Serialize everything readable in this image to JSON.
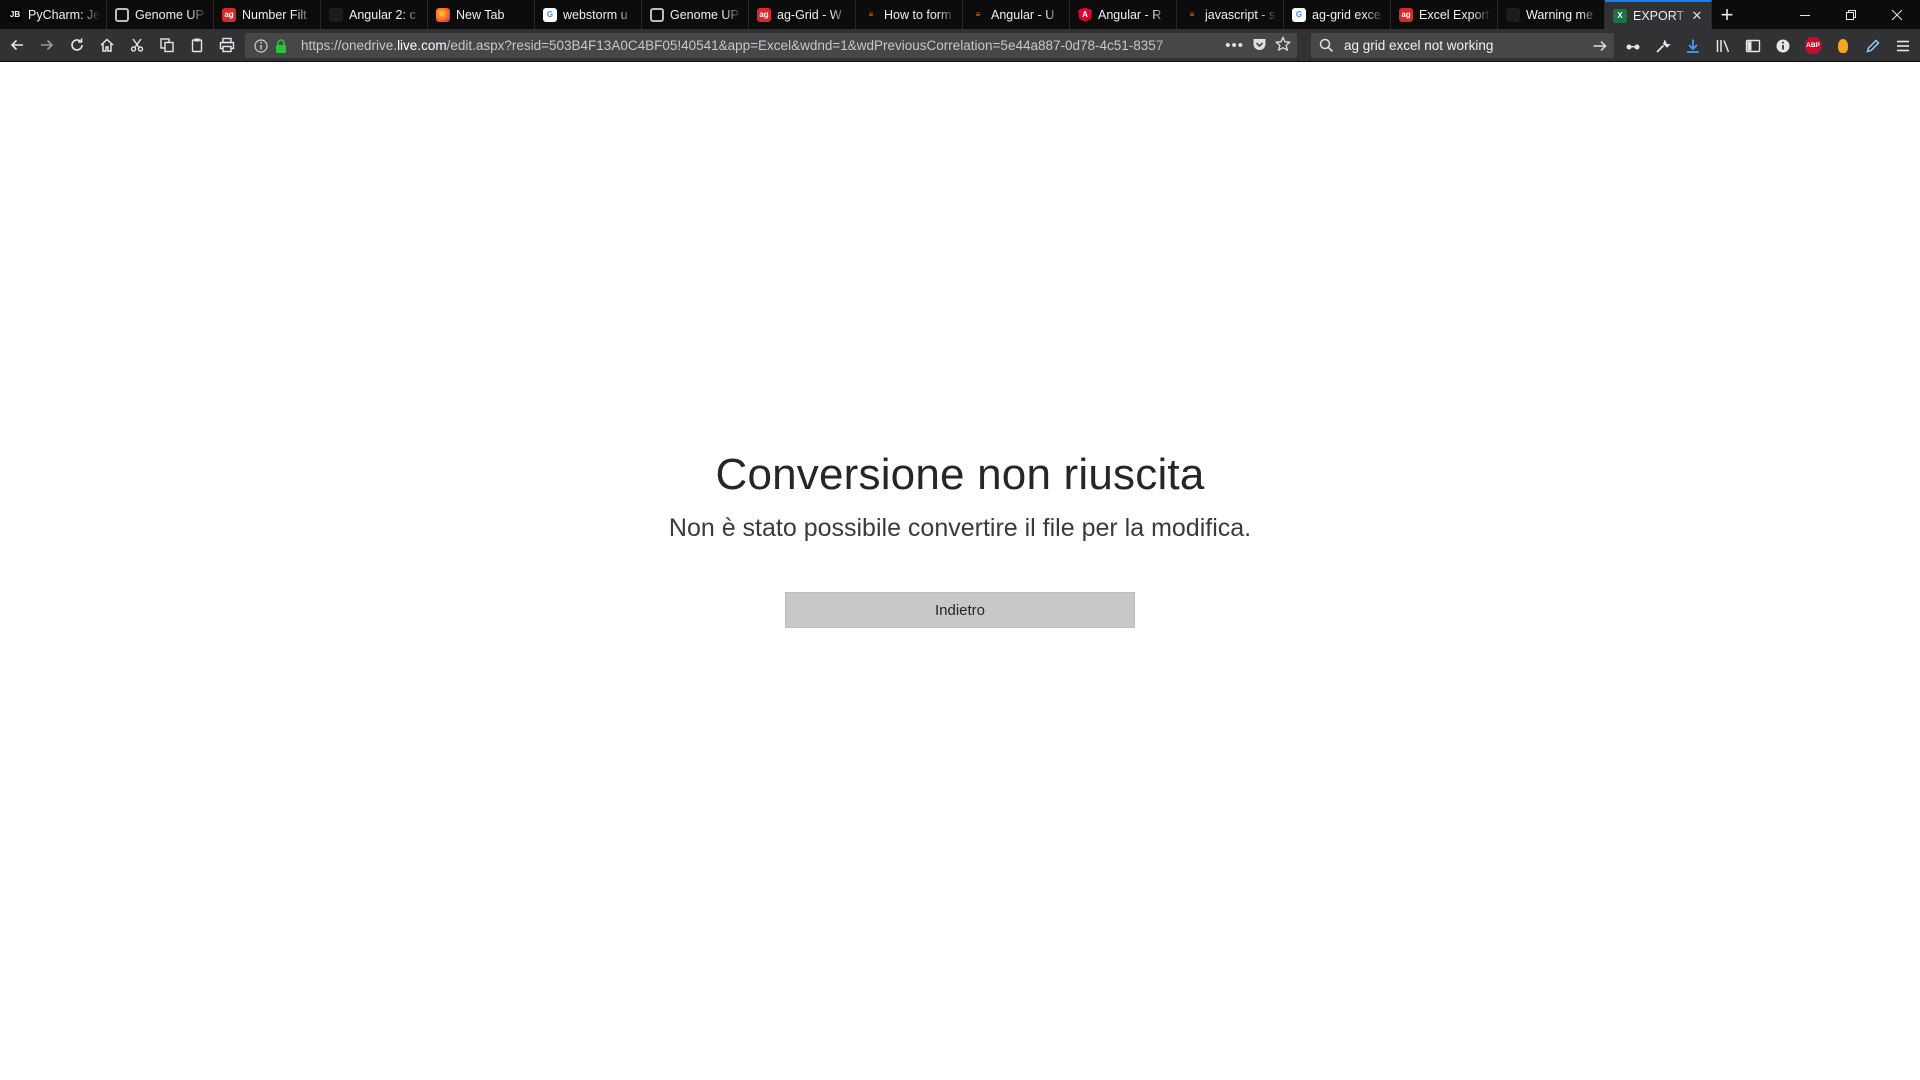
{
  "browser": {
    "tabs": [
      {
        "title": "PyCharm: Je",
        "icon": "pycharm-icon",
        "fav": "JB"
      },
      {
        "title": "Genome UP",
        "icon": "genome-up-icon",
        "fav": ""
      },
      {
        "title": "Number Filt",
        "icon": "ag-grid-icon",
        "fav": "ag"
      },
      {
        "title": "Angular 2: c",
        "icon": "github-icon",
        "fav": ""
      },
      {
        "title": "New Tab",
        "icon": "firefox-icon",
        "fav": ""
      },
      {
        "title": "webstorm u",
        "icon": "google-icon",
        "fav": "G"
      },
      {
        "title": "Genome UP",
        "icon": "genome-up-icon",
        "fav": ""
      },
      {
        "title": "ag-Grid - W",
        "icon": "ag-grid-icon",
        "fav": "ag"
      },
      {
        "title": "How to form",
        "icon": "stackoverflow-icon",
        "fav": "≡"
      },
      {
        "title": "Angular - U",
        "icon": "stackoverflow-icon",
        "fav": "≡"
      },
      {
        "title": "Angular - R",
        "icon": "angular-icon",
        "fav": "A"
      },
      {
        "title": "javascript - s",
        "icon": "stackoverflow-icon",
        "fav": "≡"
      },
      {
        "title": "ag-grid exce",
        "icon": "google-icon",
        "fav": "G"
      },
      {
        "title": "Excel Export",
        "icon": "ag-grid-icon",
        "fav": "ag"
      },
      {
        "title": "Warning me",
        "icon": "github-icon",
        "fav": ""
      },
      {
        "title": "EXPORT",
        "icon": "excel-icon",
        "fav": "X",
        "active": true
      }
    ],
    "url": {
      "prefix": "https://onedrive.",
      "domain": "live.com",
      "suffix": "/edit.aspx?resid=503B4F13A0C4BF05!40541&app=Excel&wdnd=1&wdPreviousCorrelation=5e44a887-0d78-4c51-8357"
    },
    "search": {
      "value": "ag grid excel not working"
    }
  },
  "page": {
    "error_title": "Conversione non riuscita",
    "error_message": "Non è stato possibile convertire il file per la modifica.",
    "back_label": "Indietro"
  }
}
